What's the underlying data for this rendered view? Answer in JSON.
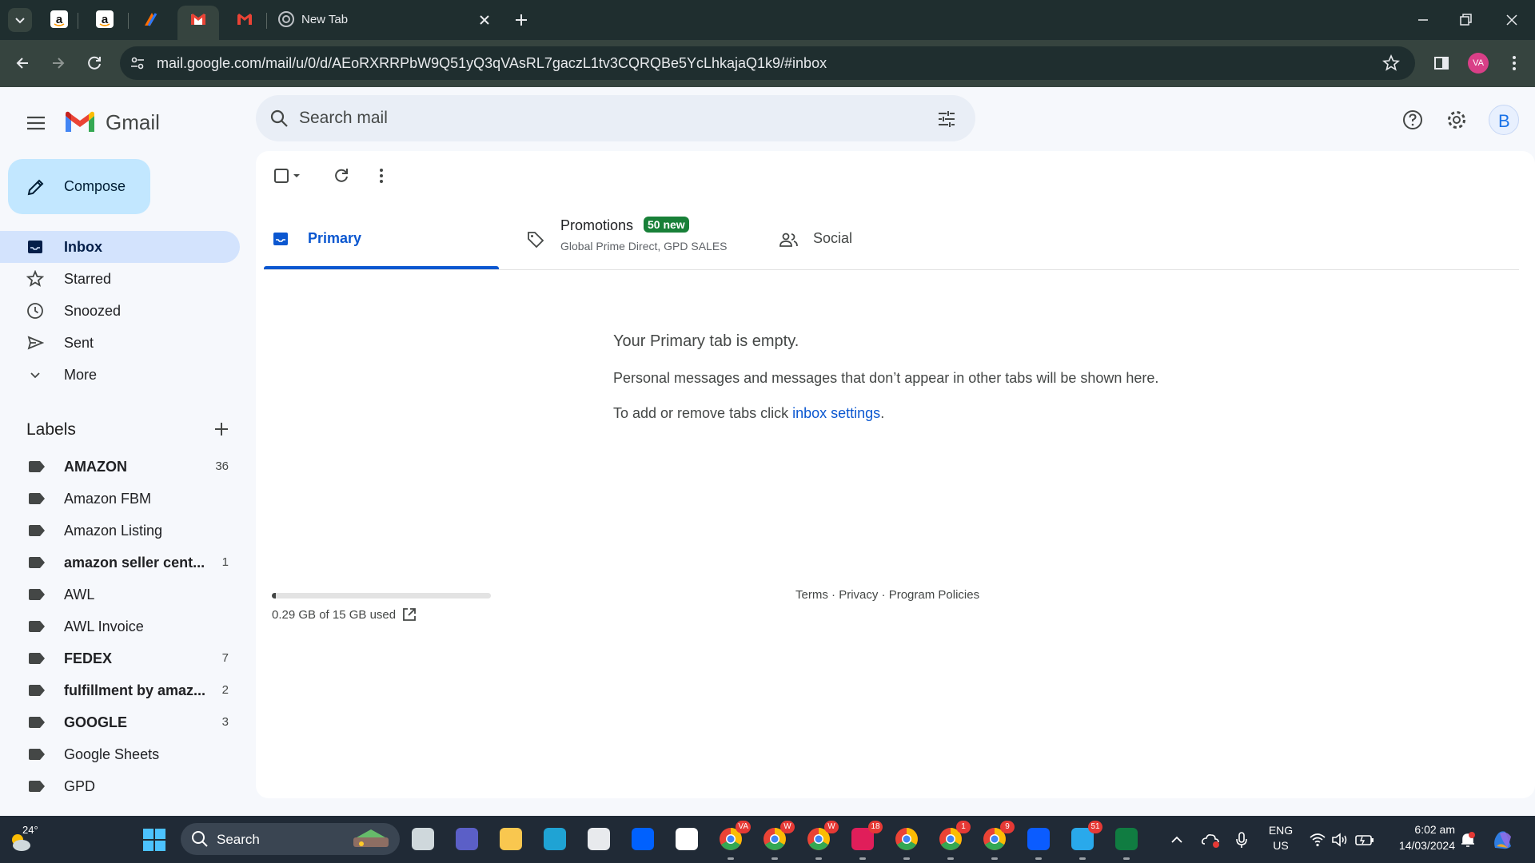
{
  "browser": {
    "tabs": [
      {
        "title": "",
        "favicon": "amazon-icon"
      },
      {
        "title": "",
        "favicon": "amazon-icon"
      },
      {
        "title": "",
        "favicon": "zapier-icon"
      },
      {
        "title": "",
        "favicon": "gmail-icon",
        "active": true
      },
      {
        "title": "",
        "favicon": "gmail-icon"
      },
      {
        "title": "New Tab",
        "favicon": "chrome-icon"
      }
    ],
    "url": "mail.google.com/mail/u/0/d/AEoRXRRPbW9Q51yQ3qVAsRL7gaczL1tv3CQRQBe5YcLhkajaQ1k9/#inbox",
    "profile_initials": "VA"
  },
  "gmail": {
    "brand": "Gmail",
    "search_placeholder": "Search mail",
    "account_initial": "B",
    "compose_label": "Compose",
    "nav": [
      {
        "label": "Inbox",
        "icon": "inbox-icon",
        "active": true
      },
      {
        "label": "Starred",
        "icon": "star-icon"
      },
      {
        "label": "Snoozed",
        "icon": "clock-icon"
      },
      {
        "label": "Sent",
        "icon": "send-icon"
      },
      {
        "label": "More",
        "icon": "chevron-down-icon"
      }
    ],
    "labels_title": "Labels",
    "labels": [
      {
        "name": "AMAZON",
        "count": "36",
        "bold": true
      },
      {
        "name": "Amazon FBM",
        "count": "",
        "bold": false
      },
      {
        "name": "Amazon Listing",
        "count": "",
        "bold": false
      },
      {
        "name": "amazon seller cent...",
        "count": "1",
        "bold": true
      },
      {
        "name": "AWL",
        "count": "",
        "bold": false
      },
      {
        "name": "AWL Invoice",
        "count": "",
        "bold": false
      },
      {
        "name": "FEDEX",
        "count": "7",
        "bold": true
      },
      {
        "name": "fulfillment by amaz...",
        "count": "2",
        "bold": true
      },
      {
        "name": "GOOGLE",
        "count": "3",
        "bold": true
      },
      {
        "name": "Google Sheets",
        "count": "",
        "bold": false
      },
      {
        "name": "GPD",
        "count": "",
        "bold": false
      }
    ],
    "category_tabs": {
      "primary": "Primary",
      "promotions": "Promotions",
      "promotions_badge": "50 new",
      "promotions_senders": "Global Prime Direct, GPD SALES",
      "social": "Social"
    },
    "empty_state": {
      "title": "Your Primary tab is empty.",
      "message": "Personal messages and messages that don’t appear in other tabs will be shown here.",
      "hint_prefix": "To add or remove tabs click ",
      "hint_link": "inbox settings",
      "hint_suffix": "."
    },
    "storage": {
      "text": "0.29 GB of 15 GB used",
      "used_fraction": 0.019
    },
    "footer": {
      "terms": "Terms",
      "privacy": "Privacy",
      "policies": "Program Policies",
      "sep": " · "
    }
  },
  "taskbar": {
    "weather": "24°",
    "search_label": "Search",
    "apps": [
      {
        "name": "task-view",
        "badge": ""
      },
      {
        "name": "teams",
        "badge": ""
      },
      {
        "name": "file-explorer",
        "badge": ""
      },
      {
        "name": "edge",
        "badge": ""
      },
      {
        "name": "store",
        "badge": ""
      },
      {
        "name": "dropbox",
        "badge": ""
      },
      {
        "name": "amazon",
        "badge": ""
      },
      {
        "name": "chrome",
        "badge": "VA"
      },
      {
        "name": "chrome",
        "badge": "W"
      },
      {
        "name": "chrome",
        "badge": "W"
      },
      {
        "name": "slack",
        "badge": "18"
      },
      {
        "name": "chrome",
        "badge": ""
      },
      {
        "name": "chrome",
        "badge": "1"
      },
      {
        "name": "chrome",
        "badge": "9"
      },
      {
        "name": "zoom",
        "badge": ""
      },
      {
        "name": "telegram",
        "badge": "51"
      },
      {
        "name": "excel",
        "badge": ""
      }
    ],
    "lang": "ENG",
    "region": "US",
    "time": "6:02 am",
    "date": "14/03/2024"
  },
  "colors": {
    "accent": "#0b57d0",
    "active_nav": "#d3e3fd",
    "compose_bg": "#c2e7ff",
    "badge_green": "#188038"
  }
}
